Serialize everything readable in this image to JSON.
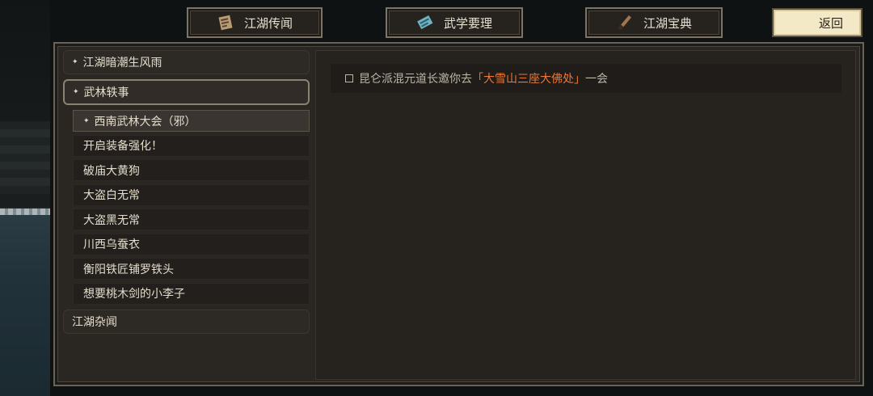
{
  "tabs": [
    {
      "label": "江湖传闻",
      "icon": "scroll-icon"
    },
    {
      "label": "武学要理",
      "icon": "book-icon"
    },
    {
      "label": "江湖宝典",
      "icon": "brush-icon"
    }
  ],
  "back_label": "返回",
  "categories": {
    "top": "江湖暗潮生风雨",
    "active": "武林轶事",
    "bottom": "江湖杂闻"
  },
  "sub_items": [
    "西南武林大会（邪）",
    "开启装备强化！",
    "破庙大黄狗",
    "大盗白无常",
    "大盗黑无常",
    "川西乌蚕衣",
    "衡阳铁匠铺罗铁头",
    "想要桃木剑的小李子"
  ],
  "quest": {
    "prefix": "昆仑派混元道长邀你去",
    "highlight": "「大雪山三座大佛处」",
    "suffix": "一会"
  },
  "colors": {
    "highlight": "#e8793a",
    "back_button": "#f3e9c6"
  }
}
